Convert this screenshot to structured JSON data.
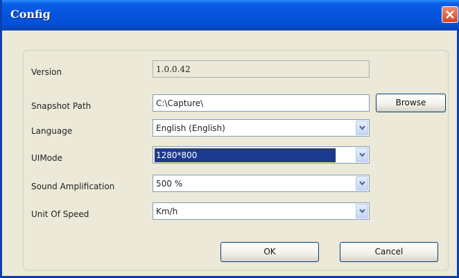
{
  "window": {
    "title": "Config"
  },
  "fields": {
    "version": {
      "label": "Version",
      "value": "1.0.0.42"
    },
    "snapshot_path": {
      "label": "Snapshot Path",
      "value": "C:\\Capture\\"
    },
    "language": {
      "label": "Language",
      "value": "English (English)"
    },
    "ui_mode": {
      "label": "UIMode",
      "value": "1280*800"
    },
    "sound_amplification": {
      "label": "Sound Amplification",
      "value": "500 %"
    },
    "unit_of_speed": {
      "label": "Unit Of Speed",
      "value": "Km/h"
    }
  },
  "buttons": {
    "browse": "Browse",
    "ok": "OK",
    "cancel": "Cancel"
  },
  "icons": {
    "close": "close-icon",
    "dropdown": "chevron-down-icon"
  },
  "colors": {
    "titlebar": "#0654df",
    "window_bg": "#ece9d8",
    "selection": "#1c3a8f"
  }
}
